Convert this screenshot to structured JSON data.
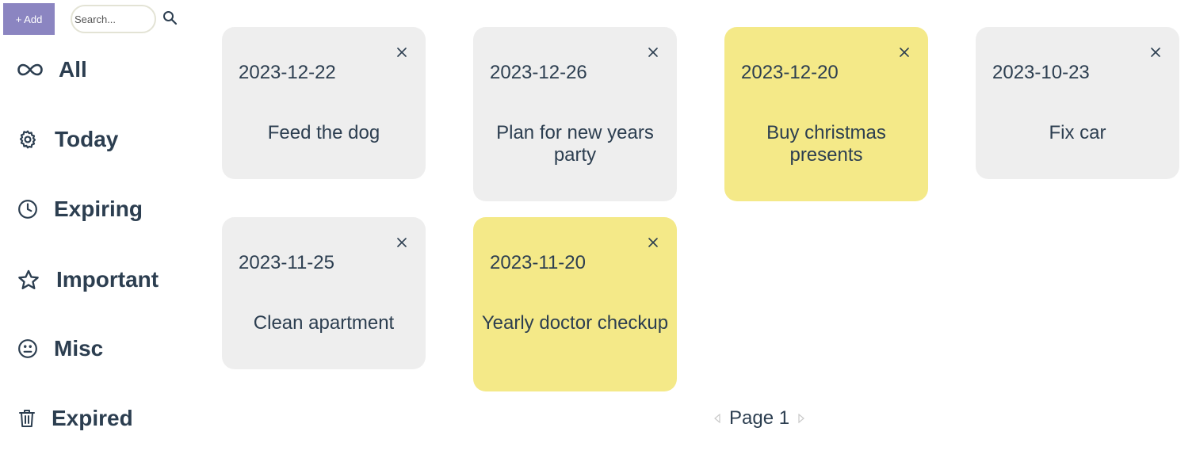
{
  "toolbar": {
    "add_label": "+ Add",
    "search_placeholder": "Search...",
    "search_value": ""
  },
  "sidebar": {
    "items": [
      {
        "label": "All",
        "icon": "infinity-icon"
      },
      {
        "label": "Today",
        "icon": "gear-icon"
      },
      {
        "label": "Expiring",
        "icon": "clock-icon"
      },
      {
        "label": "Important",
        "icon": "star-icon"
      },
      {
        "label": "Misc",
        "icon": "face-icon"
      },
      {
        "label": "Expired",
        "icon": "trash-icon"
      }
    ]
  },
  "notes": [
    {
      "date": "2023-12-22",
      "text": "Feed the dog",
      "important": false
    },
    {
      "date": "2023-12-26",
      "text": "Plan for new years party",
      "important": false
    },
    {
      "date": "2023-12-20",
      "text": "Buy christmas presents",
      "important": true
    },
    {
      "date": "2023-10-23",
      "text": "Fix car",
      "important": false
    },
    {
      "date": "2023-11-25",
      "text": "Clean apartment",
      "important": false
    },
    {
      "date": "2023-11-20",
      "text": "Yearly doctor checkup",
      "important": true
    }
  ],
  "pagination": {
    "label": "Page 1"
  },
  "colors": {
    "accent": "#8b85c1",
    "card": "#eeeeee",
    "card_important": "#f4e988",
    "text": "#2c3e50"
  }
}
